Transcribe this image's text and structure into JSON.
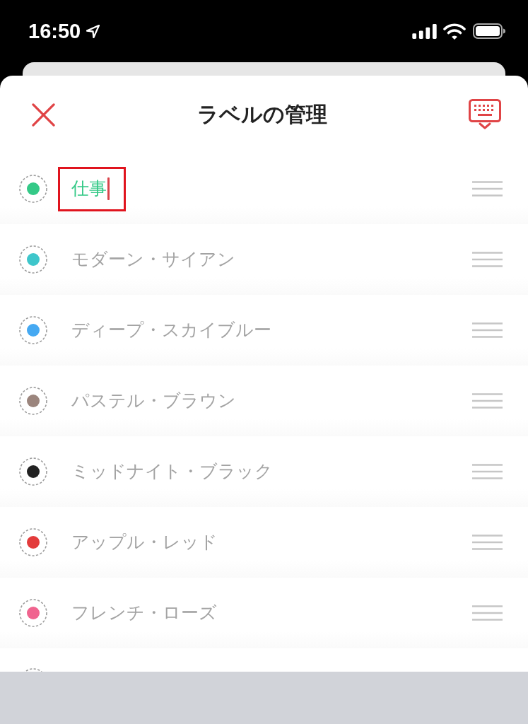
{
  "status_bar": {
    "time": "16:50"
  },
  "sheet": {
    "title": "ラベルの管理"
  },
  "labels": [
    {
      "name": "仕事",
      "color": "#34c987",
      "editing": true,
      "highlighted": true
    },
    {
      "name": "モダーン・サイアン",
      "color": "#3ec6cb",
      "editing": false,
      "highlighted": false
    },
    {
      "name": "ディープ・スカイブルー",
      "color": "#45a9f2",
      "editing": false,
      "highlighted": false
    },
    {
      "name": "パステル・ブラウン",
      "color": "#9b857d",
      "editing": false,
      "highlighted": false
    },
    {
      "name": "ミッドナイト・ブラック",
      "color": "#222222",
      "editing": false,
      "highlighted": false
    },
    {
      "name": "アップル・レッド",
      "color": "#e33b3b",
      "editing": false,
      "highlighted": false
    },
    {
      "name": "フレンチ・ローズ",
      "color": "#f0648f",
      "editing": false,
      "highlighted": false
    }
  ],
  "more_below": true
}
